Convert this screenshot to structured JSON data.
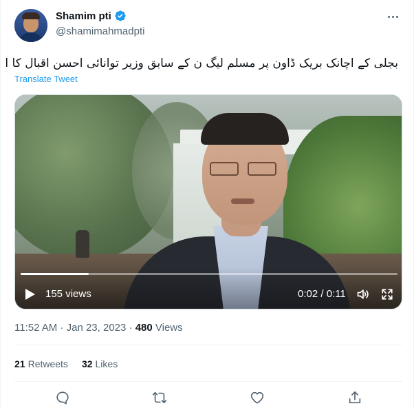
{
  "author": {
    "display_name": "Shamim pti",
    "handle": "@shamimahmadpti",
    "verified": true
  },
  "tweet": {
    "text": "بجلی کے اچانک بریک ڈاون پر مسلم لیگ ن کے سابق وزیر توانائی احسن اقبال کا اہم بیان ۔ ۔",
    "translate_label": "Translate Tweet"
  },
  "video": {
    "views_label": "155 views",
    "time_label": "0:02 / 0:11",
    "progress": 0.18
  },
  "meta": {
    "time": "11:52 AM",
    "sep1": " · ",
    "date": "Jan 23, 2023",
    "sep2": " · ",
    "views_count": "480",
    "views_label": " Views"
  },
  "stats": {
    "retweets_count": "21",
    "retweets_label": "Retweets",
    "likes_count": "32",
    "likes_label": "Likes"
  },
  "colors": {
    "accent": "#1d9bf0",
    "secondary_text": "#536471",
    "primary_text": "#0f1419"
  },
  "icons": [
    "verified-badge-icon",
    "more-icon",
    "play-icon",
    "volume-icon",
    "fullscreen-icon",
    "reply-icon",
    "retweet-icon",
    "like-icon",
    "share-icon"
  ]
}
